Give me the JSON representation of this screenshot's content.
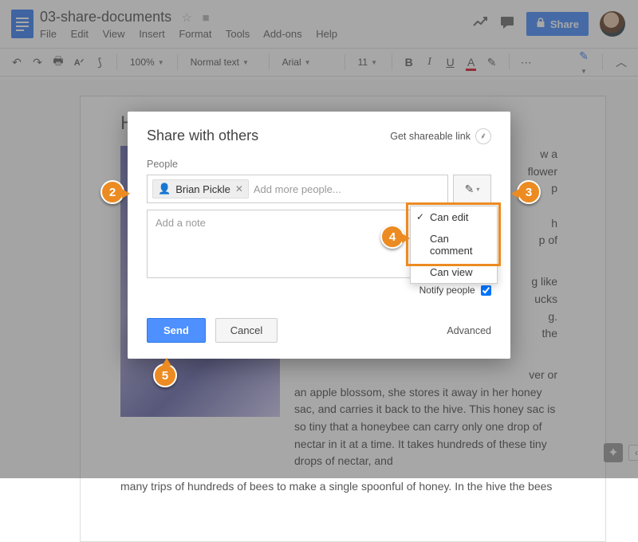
{
  "header": {
    "doc_name": "03-share-documents",
    "menus": [
      "File",
      "Edit",
      "View",
      "Insert",
      "Format",
      "Tools",
      "Add-ons",
      "Help"
    ],
    "share_label": "Share"
  },
  "toolbar": {
    "zoom": "100%",
    "style": "Normal text",
    "font": "Arial",
    "size": "11"
  },
  "document": {
    "title": "Honey Gatherers",
    "para1_a": "w a",
    "para1_b": "flower",
    "para1_c": "p",
    "para1_d": "h",
    "para1_e": "p of",
    "para2_a": "g like",
    "para2_b": "ucks",
    "para2_c": "g.",
    "para2_d": "the",
    "para3_a": "ver or",
    "para3_rest": "an apple blossom, she stores it away in her honey sac, and carries it back to the hive. This honey sac is so tiny that a honeybee can carry only one drop of nectar in it at a time. It takes hundreds of these tiny drops of nectar, and",
    "para3_wide": "many trips of hundreds of bees to make a single spoonful of honey. In the hive the bees"
  },
  "modal": {
    "title": "Share with others",
    "get_link": "Get shareable link",
    "people_label": "People",
    "chip_name": "Brian Pickle",
    "add_more_placeholder": "Add more people...",
    "note_placeholder": "Add a note",
    "notify_label": "Notify people",
    "send": "Send",
    "cancel": "Cancel",
    "advanced": "Advanced",
    "perm_options": {
      "edit": "Can edit",
      "comment": "Can comment",
      "view": "Can view"
    }
  },
  "annotations": {
    "b2": "2",
    "b3": "3",
    "b4": "4",
    "b5": "5"
  }
}
